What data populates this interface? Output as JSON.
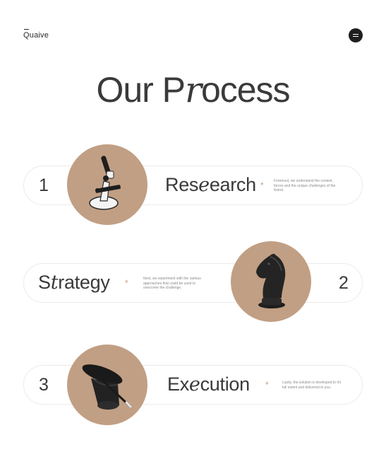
{
  "header": {
    "logo": "Quaive",
    "menu_icon": "hamburger-menu-icon"
  },
  "title": {
    "prefix": "Our P",
    "italic": "r",
    "suffix": "ocess"
  },
  "steps": [
    {
      "number": "1",
      "title_start": "Res",
      "title_italic": "e",
      "title_end": "earch",
      "asterisk": "*",
      "description": "Foremost, we understand the context, forces and the unique challenges of the brand.",
      "image_icon": "microscope-icon"
    },
    {
      "number": "2",
      "title_start": "S",
      "title_italic": "t",
      "title_end": "rategy",
      "asterisk": "*",
      "description": "Next, we experiment with the various approaches that could be used to overcome the challenge.",
      "image_icon": "chess-knight-icon"
    },
    {
      "number": "3",
      "title_start": "Ex",
      "title_italic": "e",
      "title_end": "cution",
      "asterisk": "*",
      "description": "Lastly, the solution is developed to it's full extent and delivered to you.",
      "image_icon": "magic-hat-icon"
    }
  ],
  "colors": {
    "circle": "#c19f84",
    "asterisk": "#c9a183",
    "text": "#3a3a3a",
    "pill_border": "#ebebeb"
  }
}
